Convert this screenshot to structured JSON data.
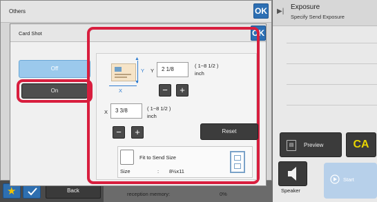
{
  "others": {
    "title": "Others",
    "ok_label": "OK"
  },
  "card_shot": {
    "title": "Card Shot",
    "ok_label": "OK",
    "off_label": "Off",
    "on_label": "On",
    "y_axis_label": "Y",
    "y_field_label": "Y",
    "y_value": "2 1/8",
    "y_range": "( 1~8 1/2 )",
    "y_unit": "inch",
    "x_axis_label": "X",
    "x_field_label": "X",
    "x_value": "3 3/8",
    "x_range": "( 1~8 1/2 )",
    "x_unit": "inch",
    "minus": "−",
    "plus": "+",
    "reset_label": "Reset",
    "fit_label": "Fit to Send Size",
    "size_label": "Size",
    "size_sep": ":",
    "size_value": "8½x11"
  },
  "exposure": {
    "title": "Exposure",
    "subtitle": "Specify Send Exposure"
  },
  "right": {
    "preview_label": "Preview",
    "ca_label": "CA",
    "speaker_label": "Speaker",
    "start_label": "Start"
  },
  "bottom": {
    "back_label": "Back"
  },
  "behind": {
    "reception_label": "reception memory:",
    "reception_value": "0%"
  },
  "colors": {
    "accent": "#2d6fb3",
    "highlight": "#d81e3e",
    "ca": "#e8d400"
  }
}
